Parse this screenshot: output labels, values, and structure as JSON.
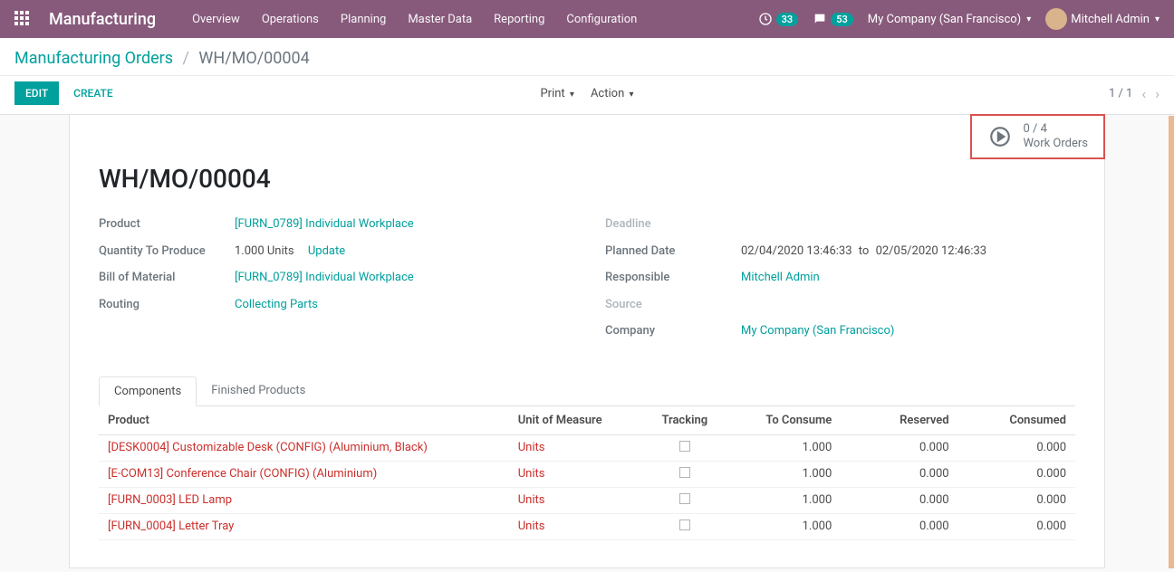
{
  "navbar": {
    "brand": "Manufacturing",
    "menu": [
      "Overview",
      "Operations",
      "Planning",
      "Master Data",
      "Reporting",
      "Configuration"
    ],
    "activity_count": "33",
    "discuss_count": "53",
    "company": "My Company (San Francisco)",
    "user": "Mitchell Admin"
  },
  "breadcrumb": {
    "root": "Manufacturing Orders",
    "current": "WH/MO/00004"
  },
  "toolbar": {
    "edit": "EDIT",
    "create": "CREATE",
    "print": "Print",
    "action": "Action",
    "pager": "1 / 1"
  },
  "stat_button": {
    "count": "0 / 4",
    "label": "Work Orders"
  },
  "record": {
    "title": "WH/MO/00004",
    "left": {
      "product_label": "Product",
      "product_value": "[FURN_0789] Individual Workplace",
      "qty_label": "Quantity To Produce",
      "qty_value": "1.000 Units",
      "qty_update": "Update",
      "bom_label": "Bill of Material",
      "bom_value": "[FURN_0789] Individual Workplace",
      "routing_label": "Routing",
      "routing_value": "Collecting Parts"
    },
    "right": {
      "deadline_label": "Deadline",
      "planned_label": "Planned Date",
      "planned_from": "02/04/2020 13:46:33",
      "planned_to_word": "to",
      "planned_to": "02/05/2020 12:46:33",
      "responsible_label": "Responsible",
      "responsible_value": "Mitchell Admin",
      "source_label": "Source",
      "company_label": "Company",
      "company_value": "My Company (San Francisco)"
    }
  },
  "tabs": {
    "components": "Components",
    "finished": "Finished Products"
  },
  "table": {
    "headers": {
      "product": "Product",
      "uom": "Unit of Measure",
      "tracking": "Tracking",
      "to_consume": "To Consume",
      "reserved": "Reserved",
      "consumed": "Consumed"
    },
    "rows": [
      {
        "product": "[DESK0004] Customizable Desk (CONFIG) (Aluminium, Black)",
        "uom": "Units",
        "to_consume": "1.000",
        "reserved": "0.000",
        "consumed": "0.000"
      },
      {
        "product": "[E-COM13] Conference Chair (CONFIG) (Aluminium)",
        "uom": "Units",
        "to_consume": "1.000",
        "reserved": "0.000",
        "consumed": "0.000"
      },
      {
        "product": "[FURN_0003] LED Lamp",
        "uom": "Units",
        "to_consume": "1.000",
        "reserved": "0.000",
        "consumed": "0.000"
      },
      {
        "product": "[FURN_0004] Letter Tray",
        "uom": "Units",
        "to_consume": "1.000",
        "reserved": "0.000",
        "consumed": "0.000"
      }
    ]
  }
}
